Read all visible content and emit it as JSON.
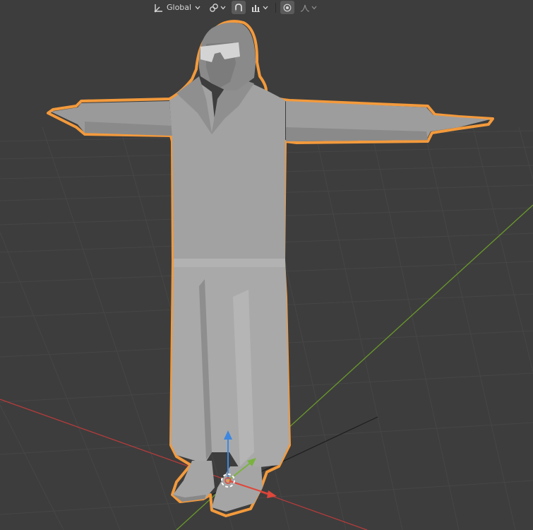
{
  "viewport": {
    "background": "#3d3d3d",
    "grid_color": "#474747",
    "x_axis_color": "#b53b3b",
    "y_axis_color": "#6a9a2a",
    "selection_outline": "#f39a3c"
  },
  "header": {
    "orientation_label": "Global",
    "orientation_icon": "transform-orientation-icon",
    "pivot_icon": "link-pivot-icon",
    "snap_icon": "magnet-snap-icon",
    "snap_target_icon": "snap-increment-icon",
    "proportional_icon": "proportional-edit-icon",
    "falloff_icon": "falloff-curve-icon"
  },
  "gizmo": {
    "colors": {
      "x": "#e0463a",
      "y": "#7ab33e",
      "z": "#3d87e0",
      "center": "#ffffff"
    }
  }
}
